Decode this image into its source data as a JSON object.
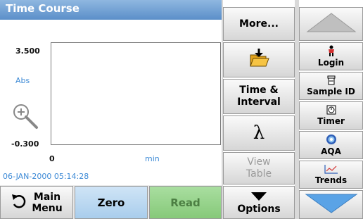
{
  "title": "Time Course",
  "chart": {
    "ymax_label": "3.500",
    "ymin_label": "-0.300",
    "yunit": "Abs",
    "xmin_label": "0",
    "xunit": "min"
  },
  "datetime": "06-JAN-2000  05:14:28",
  "middle_menu": {
    "more_label": "More...",
    "time_interval_label_1": "Time &",
    "time_interval_label_2": "Interval",
    "lambda_label": "λ",
    "view_table_label_1": "View",
    "view_table_label_2": "Table",
    "options_label": "Options"
  },
  "right_menu": {
    "login_label": "Login",
    "sample_id_label": "Sample ID",
    "timer_label": "Timer",
    "aqa_label": "AQA",
    "trends_label": "Trends"
  },
  "bottom_bar": {
    "main_menu_label_1": "Main",
    "main_menu_label_2": "Menu",
    "zero_label": "Zero",
    "read_label": "Read"
  },
  "icons": {
    "zoom": "zoom-in-icon",
    "open_folder": "open-folder-icon",
    "login": "person-icon",
    "sample_id": "sample-container-icon",
    "timer": "timer-icon",
    "aqa": "aqa-icon",
    "trends": "trend-chart-icon",
    "main_menu": "back-arrow-icon"
  },
  "colors": {
    "title_bar": "#6f9fd4",
    "axis_label_blue": "#3d8ad6",
    "zero_button": "#bcd8f1",
    "read_button": "#98d48c"
  }
}
